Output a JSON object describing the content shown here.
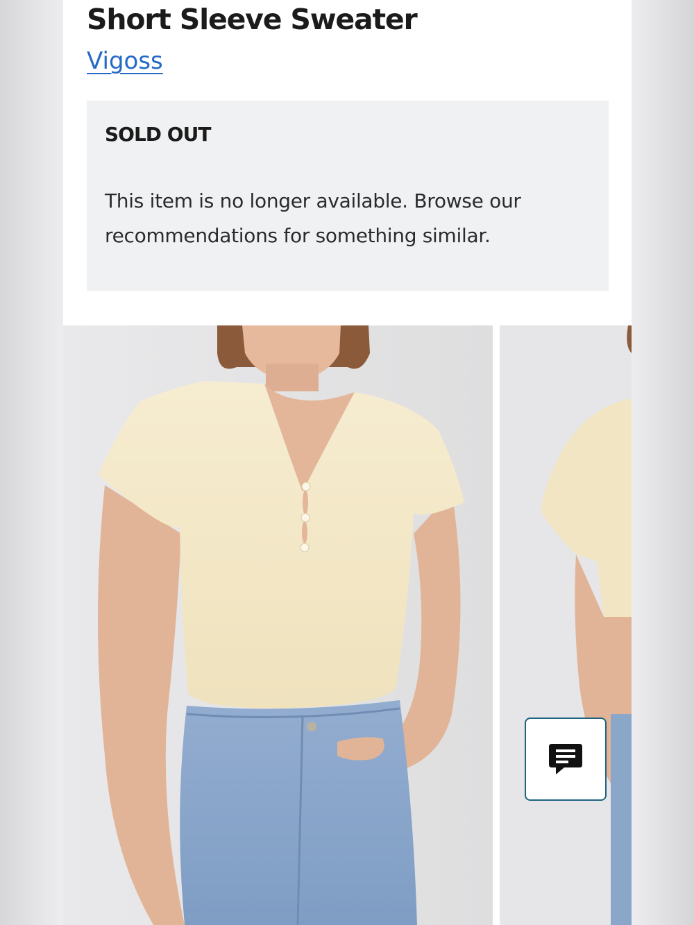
{
  "product": {
    "title": "Short Sleeve Sweater",
    "brand": "Vigoss"
  },
  "availability": {
    "status": "SOLD OUT",
    "message": "This item is no longer available. Browse our recommendations for something similar."
  },
  "gallery": {
    "images": [
      {
        "alt": "model-front-view"
      },
      {
        "alt": "model-side-view"
      }
    ]
  },
  "chat": {
    "icon": "chat-bubble-icon"
  },
  "colors": {
    "brand_link": "#2469c6",
    "notice_bg": "#f0f1f3",
    "sweater": "#f3e7c4",
    "denim": "#8aa7c9",
    "chat_border": "#1e6380"
  }
}
